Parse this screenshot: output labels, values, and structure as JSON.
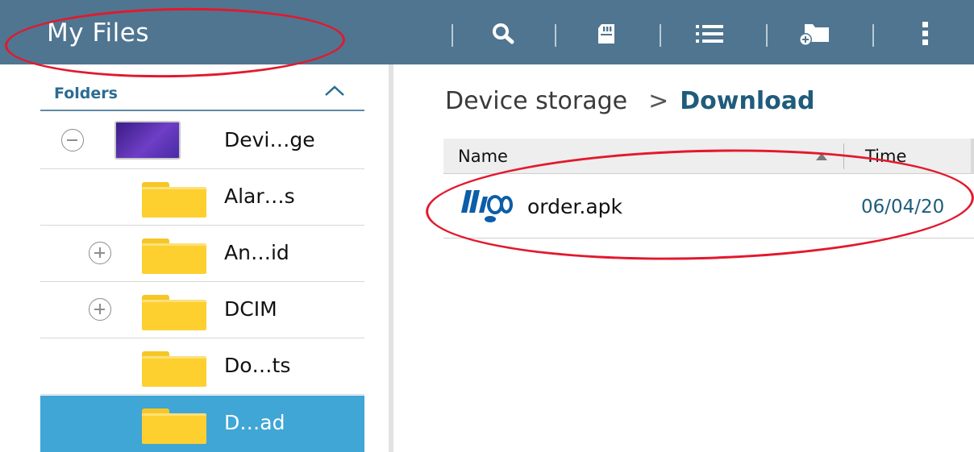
{
  "app": {
    "title": "My Files"
  },
  "toolbar": {
    "icons": [
      "search-icon",
      "sd-card-icon",
      "list-view-icon",
      "new-folder-icon",
      "overflow-menu-icon"
    ]
  },
  "sidebar": {
    "header": "Folders",
    "items": [
      {
        "label": "Devi…ge",
        "expander": "collapse",
        "icon": "device-thumbnail"
      },
      {
        "label": "Alar…s",
        "expander": "none",
        "icon": "folder-icon"
      },
      {
        "label": "An…id",
        "expander": "expand",
        "icon": "folder-icon"
      },
      {
        "label": "DCIM",
        "expander": "expand",
        "icon": "folder-icon"
      },
      {
        "label": "Do…ts",
        "expander": "none",
        "icon": "folder-icon"
      },
      {
        "label": "D…ad",
        "expander": "none",
        "icon": "folder-icon",
        "selected": true
      }
    ]
  },
  "breadcrumb": {
    "parent": "Device storage",
    "separator": ">",
    "current": "Download"
  },
  "table": {
    "columns": {
      "name": "Name",
      "time": "Time"
    },
    "rows": [
      {
        "name": "order.apk",
        "time": "06/04/20"
      }
    ]
  },
  "colors": {
    "actionbar": "#4f7590",
    "selected": "#3fa6d6",
    "accent_text": "#1f5c7c",
    "folder": "#fdd030",
    "annotation": "#e3182d"
  }
}
